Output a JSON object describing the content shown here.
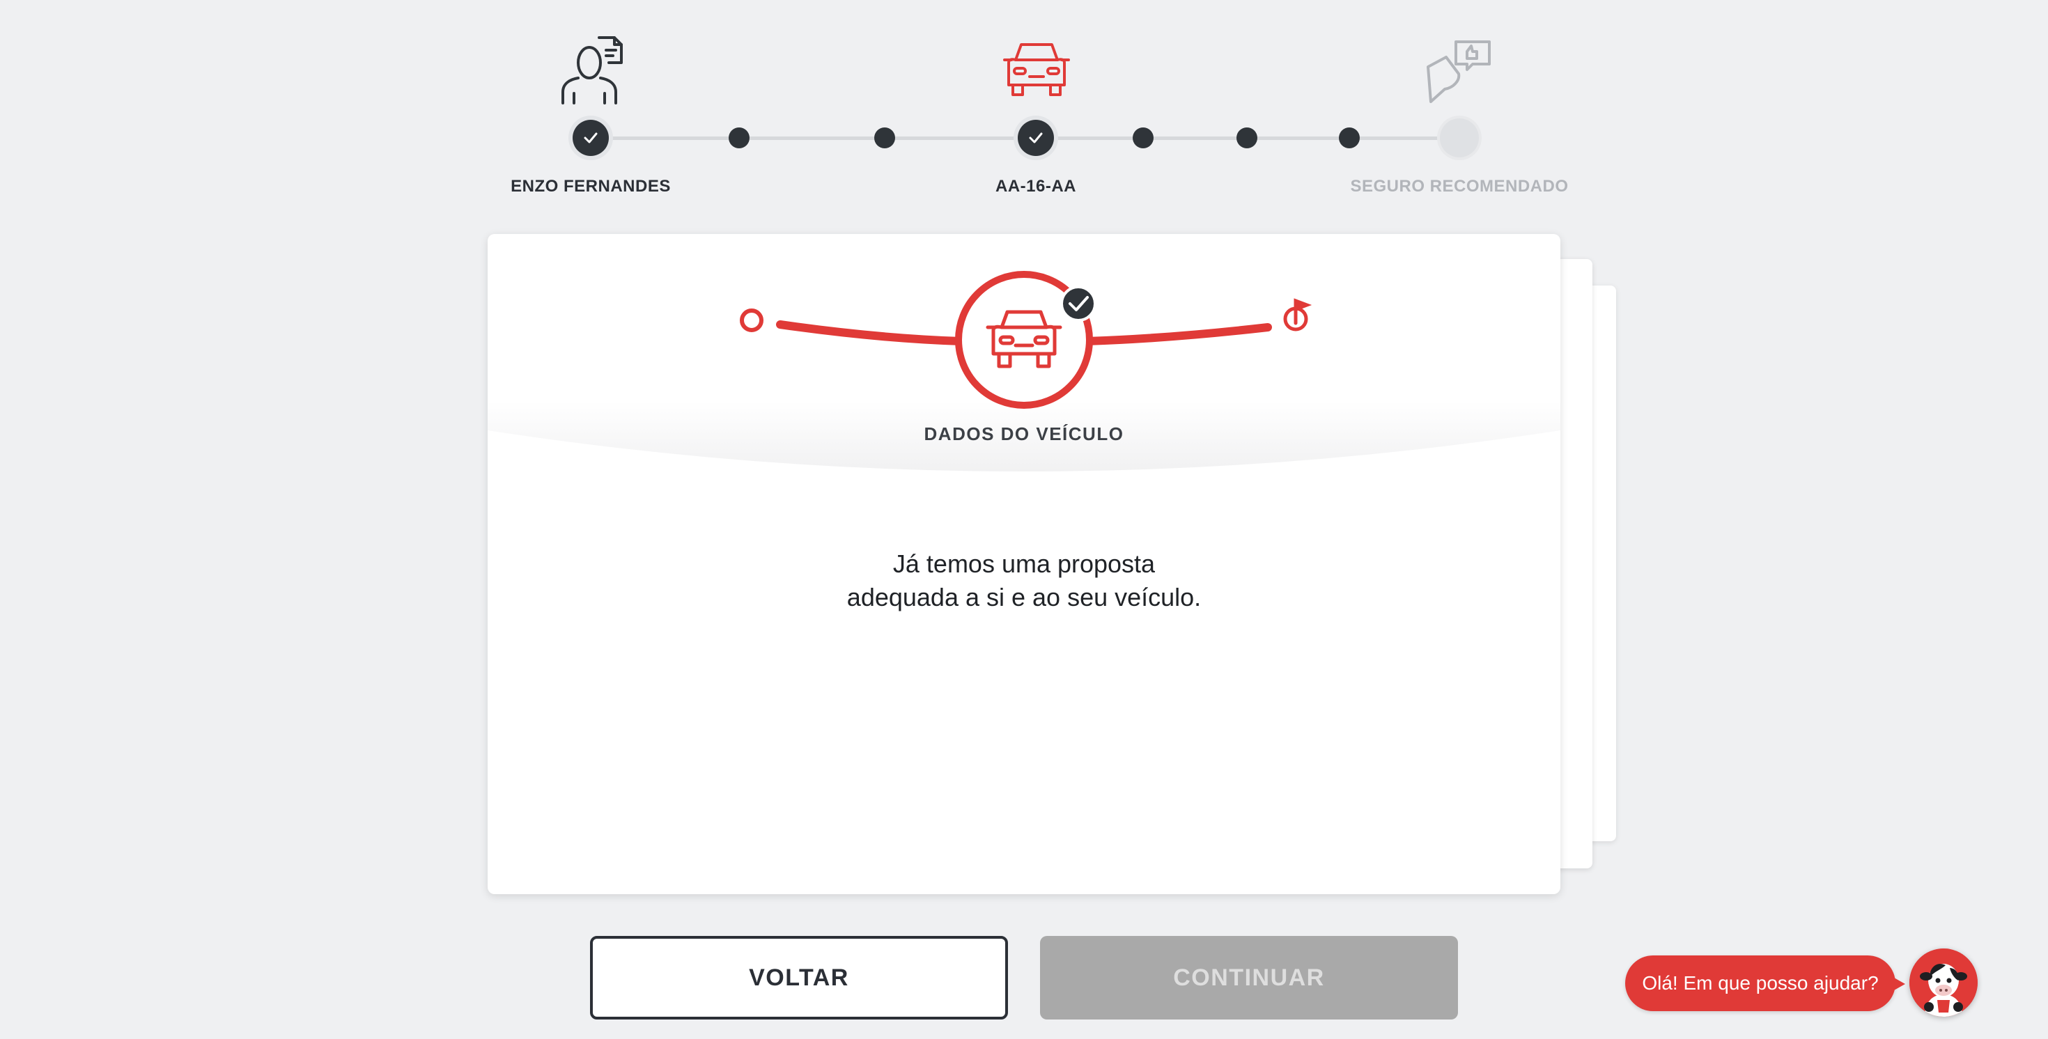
{
  "stepper": {
    "steps": [
      {
        "label": "ENZO FERNANDES",
        "state": "done",
        "icon": "person-document-icon"
      },
      {
        "label": "AA-16-AA",
        "state": "done",
        "icon": "car-icon"
      },
      {
        "label": "SEGURO RECOMENDADO",
        "state": "pending",
        "icon": "chat-thumbs-up-icon"
      }
    ]
  },
  "card": {
    "title": "DADOS DO VEÍCULO",
    "message_line1": "Já temos uma proposta",
    "message_line2": "adequada a si e ao seu veículo."
  },
  "buttons": {
    "back_label": "VOLTAR",
    "continue_label": "CONTINUAR",
    "continue_disabled": true
  },
  "chat": {
    "bubble_text": "Olá! Em que posso ajudar?"
  },
  "colors": {
    "accent": "#e03a37",
    "dark": "#2f3439",
    "background": "#eff0f2",
    "disabled": "#a9a9a9"
  }
}
